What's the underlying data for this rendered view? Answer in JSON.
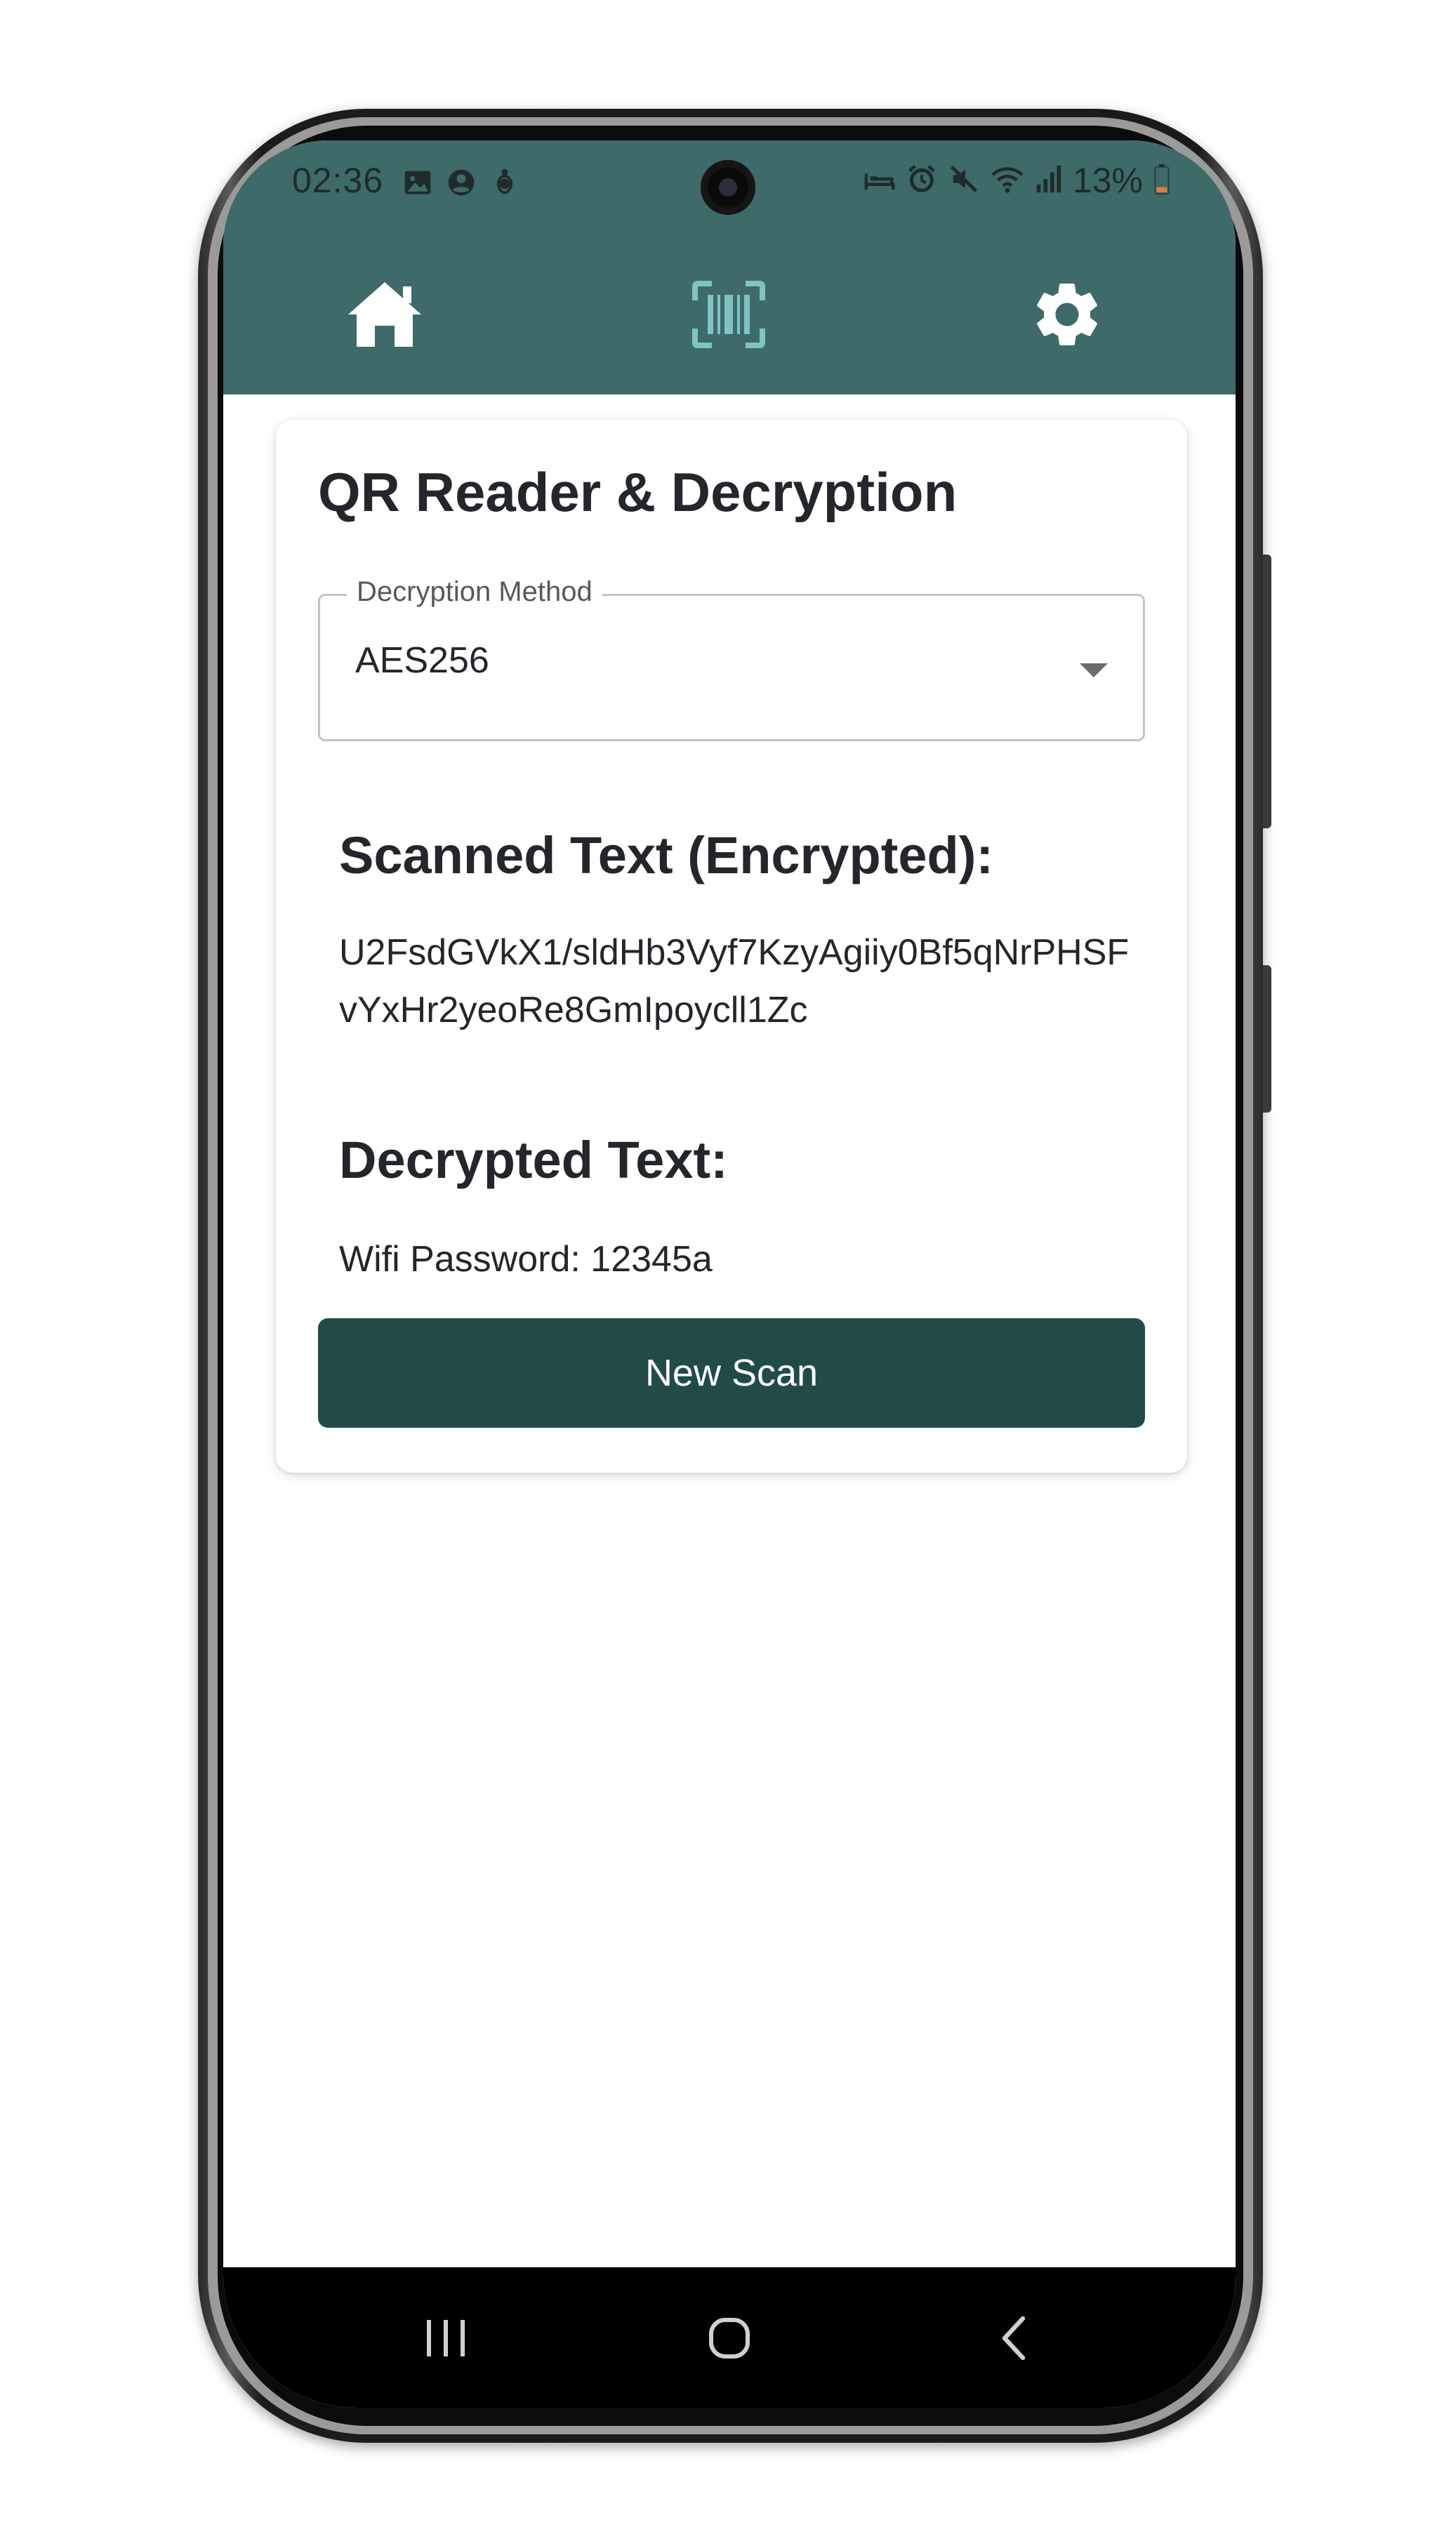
{
  "status_bar": {
    "time": "02:36",
    "battery_percent": "13%",
    "left_icons": [
      "gallery-icon",
      "account-circle-icon",
      "accessibility-icon"
    ],
    "right_icons": [
      "bed-icon",
      "alarm-icon",
      "mute-icon",
      "wifi-icon",
      "signal-icon",
      "battery-icon"
    ]
  },
  "header": {
    "background_color": "#3e6a69",
    "nav": [
      {
        "name": "home",
        "icon": "home-icon",
        "active": false,
        "color": "#ffffff"
      },
      {
        "name": "scan",
        "icon": "barcode-scan-icon",
        "active": true,
        "color": "#7fc3c3"
      },
      {
        "name": "settings",
        "icon": "gear-icon",
        "active": false,
        "color": "#ffffff"
      }
    ]
  },
  "card": {
    "title": "QR Reader & Decryption",
    "method_select": {
      "label": "Decryption Method",
      "value": "AES256"
    },
    "encrypted": {
      "heading": "Scanned Text (Encrypted):",
      "text": "U2FsdGVkX1/sldHb3Vyf7KzyAgiiy0Bf5qNrPHSFvYxHr2yeoRe8GmIpoycll1Zc"
    },
    "decrypted": {
      "heading": "Decrypted Text:",
      "text": "Wifi Password: 12345a"
    },
    "button_label": "New Scan",
    "button_color": "#214b49"
  },
  "system_nav": {
    "buttons": [
      "recent-apps-icon",
      "home-circle-icon",
      "back-icon"
    ]
  }
}
